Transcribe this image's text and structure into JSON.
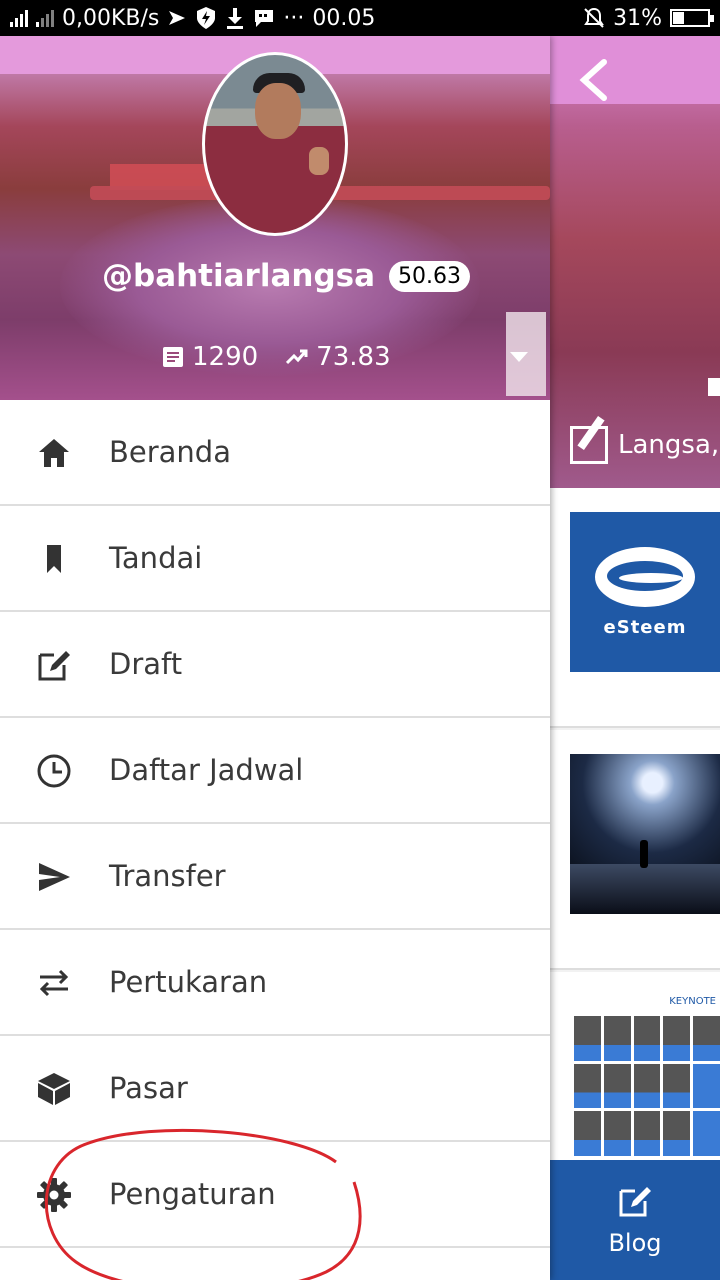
{
  "status_bar": {
    "network_speed": "0,00KB/s",
    "time": "00.05",
    "battery": "31%",
    "battery_level": 0.31,
    "icons": [
      "signal-h-icon",
      "signal-icon",
      "messenger-icon",
      "shield-bolt-icon",
      "download-icon",
      "bbm-icon",
      "more-dots-icon",
      "mute-bell-icon",
      "battery-icon"
    ],
    "more_dots": "···"
  },
  "profile": {
    "username": "@bahtiarlangsa",
    "reputation": "50.63",
    "post_count": "1290",
    "voting_power": "73.83"
  },
  "menu": {
    "items": [
      {
        "label": "Beranda",
        "icon": "home-icon"
      },
      {
        "label": "Tandai",
        "icon": "bookmark-icon"
      },
      {
        "label": "Draft",
        "icon": "edit-icon"
      },
      {
        "label": "Daftar Jadwal",
        "icon": "clock-icon"
      },
      {
        "label": "Transfer",
        "icon": "send-icon"
      },
      {
        "label": "Pertukaran",
        "icon": "swap-icon"
      },
      {
        "label": "Pasar",
        "icon": "cube-icon"
      },
      {
        "label": "Pengaturan",
        "icon": "gear-icon"
      }
    ]
  },
  "background_screen": {
    "location": "Langsa,",
    "esteem_logo_text": "eSteem",
    "collage_header": "KEYNOTE",
    "blog_button_label": "Blog"
  },
  "colors": {
    "blue": "#1f59a6",
    "annotation_red": "#d9262c",
    "header_pink": "#e49adc"
  }
}
